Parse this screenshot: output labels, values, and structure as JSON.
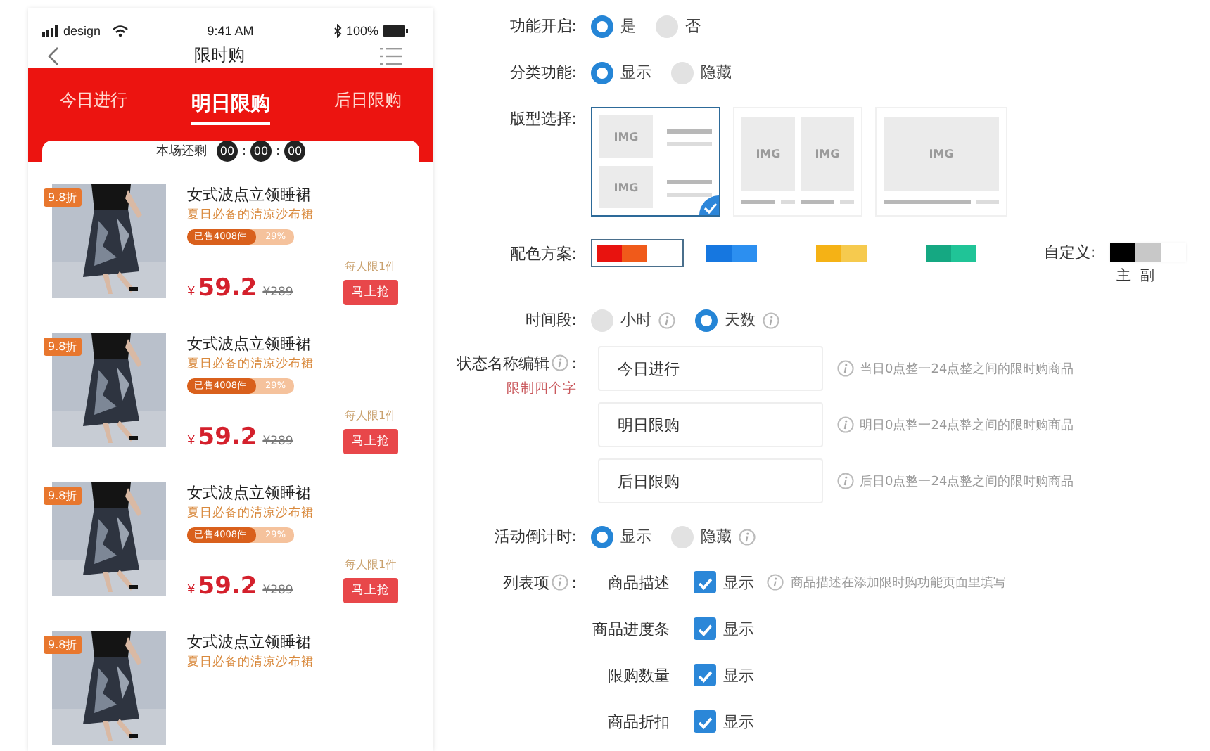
{
  "phone": {
    "status": {
      "carrier": "design",
      "time": "9:41 AM",
      "battery": "100%"
    },
    "title": "限时购",
    "tabs": [
      {
        "label": "今日进行",
        "selected": false
      },
      {
        "label": "明日限购",
        "selected": true
      },
      {
        "label": "后日限购",
        "selected": false
      }
    ],
    "countdown": {
      "label": "本场还剩",
      "digits": [
        "00",
        "00",
        "00"
      ],
      "separator": ":"
    },
    "products": [
      {
        "discount": "9.8折",
        "title": "女式波点立领睡裙",
        "subtitle": "夏日必备的清凉沙布裙",
        "sold": "已售4008件",
        "percent": "29%",
        "level": 0.65,
        "limit": "每人限1件",
        "currency": "¥",
        "price": "59.2",
        "old_price": "¥289",
        "button": "马上抢"
      },
      {
        "discount": "9.8折",
        "title": "女式波点立领睡裙",
        "subtitle": "夏日必备的清凉沙布裙",
        "sold": "已售4008件",
        "percent": "29%",
        "level": 0.65,
        "limit": "每人限1件",
        "currency": "¥",
        "price": "59.2",
        "old_price": "¥289",
        "button": "马上抢"
      },
      {
        "discount": "9.8折",
        "title": "女式波点立领睡裙",
        "subtitle": "夏日必备的清凉沙布裙",
        "sold": "已售4008件",
        "percent": "29%",
        "level": 0.65,
        "limit": "每人限1件",
        "currency": "¥",
        "price": "59.2",
        "old_price": "¥289",
        "button": "马上抢"
      },
      {
        "discount": "9.8折",
        "title": "女式波点立领睡裙",
        "subtitle": "夏日必备的清凉沙布裙"
      }
    ]
  },
  "settings": [
    {
      "kind": "radio",
      "label": "功能开启:",
      "options": [
        {
          "label": "是",
          "selected": true
        },
        {
          "label": "否",
          "selected": false
        }
      ]
    },
    {
      "kind": "radio",
      "label": "分类功能:",
      "options": [
        {
          "label": "显示",
          "selected": true
        },
        {
          "label": "隐藏",
          "selected": false
        }
      ]
    },
    {
      "kind": "layout",
      "label": "版型选择:",
      "cards": [
        {
          "kind": "list",
          "images": [
            "IMG",
            "IMG"
          ],
          "selected": true
        },
        {
          "kind": "grid",
          "images": [
            "IMG",
            "IMG"
          ],
          "selected": false
        },
        {
          "kind": "single",
          "images": [
            "IMG"
          ],
          "selected": false
        }
      ]
    },
    {
      "kind": "colors",
      "label": "配色方案:",
      "schemes": [
        {
          "swatches": [
            {
              "color": "#e8130f"
            },
            {
              "color": "#f05a1a"
            }
          ],
          "selected": true
        },
        {
          "swatches": [
            {
              "color": "#1677e0"
            },
            {
              "color": "#2c8ff0"
            }
          ],
          "selected": false
        },
        {
          "swatches": [
            {
              "color": "#f5b215"
            },
            {
              "color": "#f6ca4e"
            }
          ],
          "selected": false
        },
        {
          "swatches": [
            {
              "color": "#15a882"
            },
            {
              "color": "#20c497"
            }
          ],
          "selected": false
        }
      ],
      "custom": {
        "label": "自定义:",
        "swatches": [
          {
            "color": "#000000",
            "caption": "主"
          },
          {
            "color": "#c8c8c8",
            "caption": "副"
          }
        ]
      }
    },
    {
      "kind": "radio",
      "label": "时间段:",
      "options": [
        {
          "label": "小时",
          "selected": false,
          "info": true
        },
        {
          "label": "天数",
          "selected": true,
          "info": true
        }
      ]
    },
    {
      "kind": "names",
      "label": "状态名称编辑",
      "info": true,
      "suffix": ":",
      "note": "限制四个字",
      "inputs": [
        {
          "value": "今日进行",
          "hint": "当日0点整一24点整之间的限时购商品"
        },
        {
          "value": "明日限购",
          "hint": "明日0点整一24点整之间的限时购商品"
        },
        {
          "value": "后日限购",
          "hint": "后日0点整一24点整之间的限时购商品"
        }
      ]
    },
    {
      "kind": "radio",
      "label": "活动倒计时:",
      "options": [
        {
          "label": "显示",
          "selected": true
        },
        {
          "label": "隐藏",
          "selected": false,
          "info": true
        }
      ]
    },
    {
      "kind": "checks",
      "label": "列表项",
      "info": true,
      "suffix": ":",
      "items": [
        {
          "name": "商品描述",
          "label": "显示",
          "checked": true,
          "hint": "商品描述在添加限时购功能页面里填写"
        },
        {
          "name": "商品进度条",
          "label": "显示",
          "checked": true
        },
        {
          "name": "限购数量",
          "label": "显示",
          "checked": true
        },
        {
          "name": "商品折扣",
          "label": "显示",
          "checked": true
        }
      ]
    }
  ]
}
